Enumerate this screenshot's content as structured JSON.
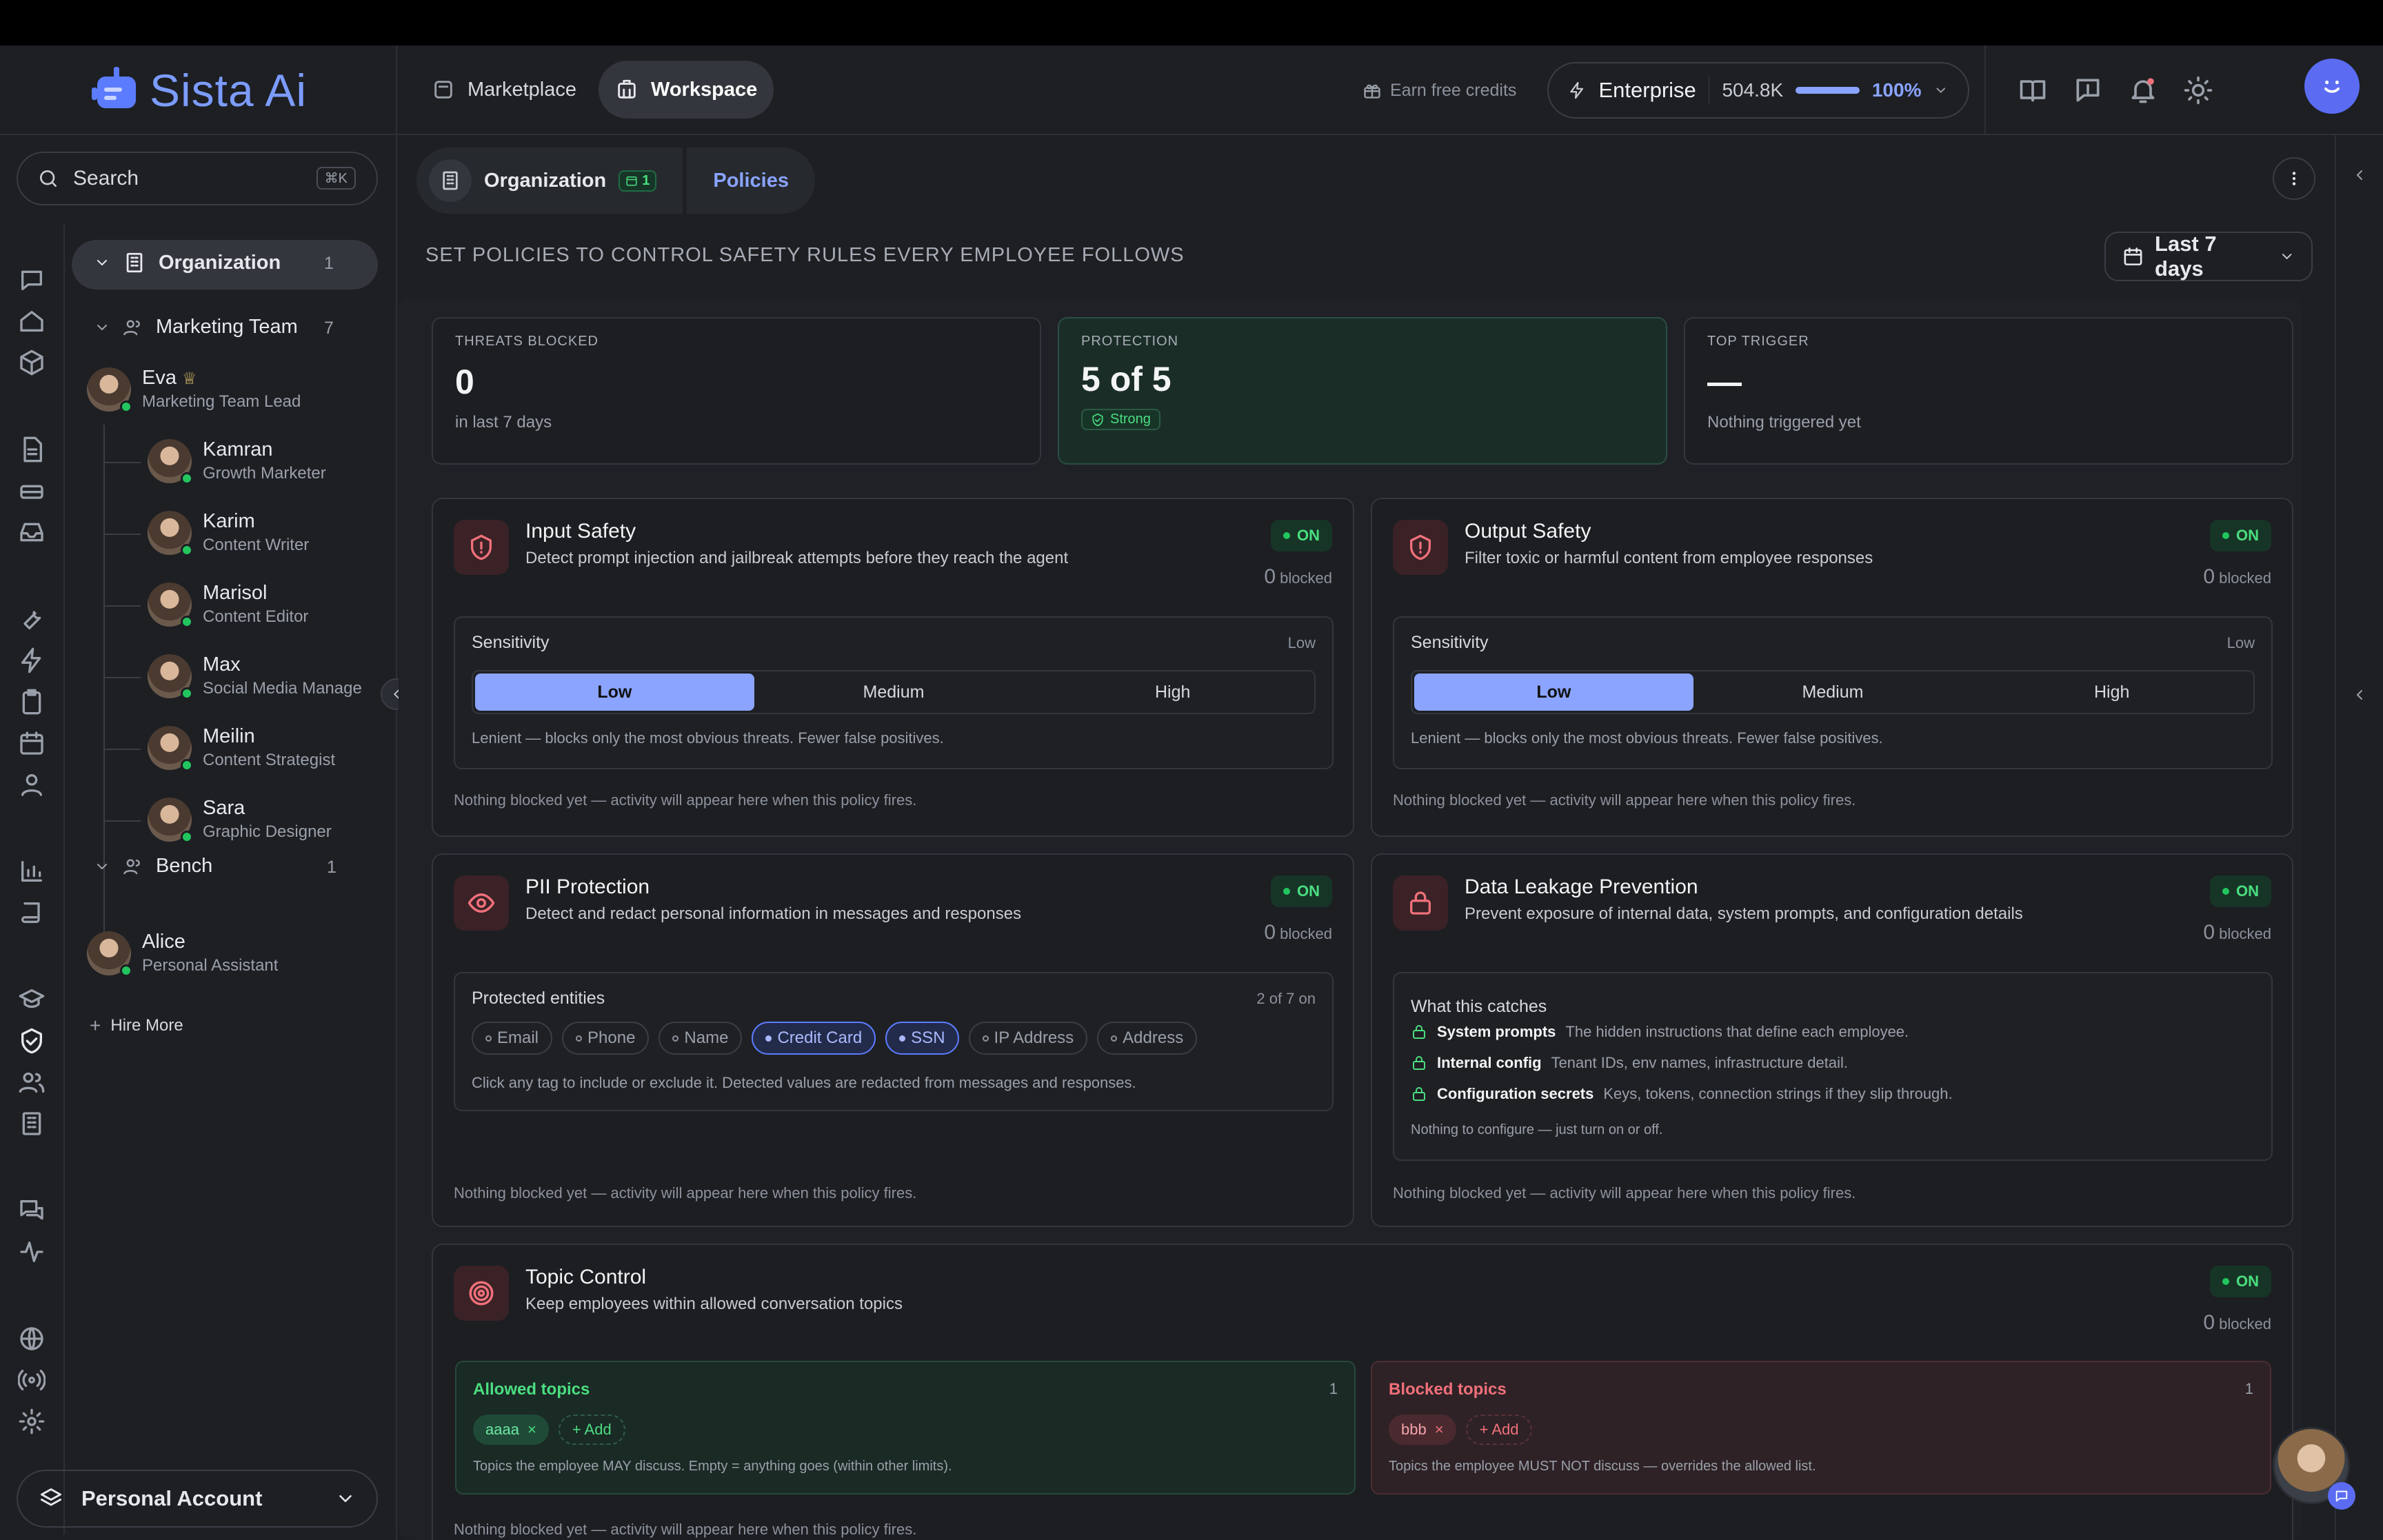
{
  "app": {
    "name": "Sista Ai"
  },
  "nav": {
    "marketplace": "Marketplace",
    "workspace": "Workspace"
  },
  "header": {
    "earn_credits": "Earn free credits",
    "plan": "Enterprise",
    "credits": "504.8K",
    "usage_percent": "100%",
    "usage_fraction": 1.0
  },
  "sidebar": {
    "search_placeholder": "Search",
    "search_shortcut": "⌘K",
    "org": {
      "label": "Organization",
      "count": "1"
    },
    "team": {
      "label": "Marketing Team",
      "count": "7"
    },
    "lead": {
      "name": "Eva",
      "role": "Marketing Team Lead"
    },
    "members": [
      {
        "name": "Kamran",
        "role": "Growth Marketer"
      },
      {
        "name": "Karim",
        "role": "Content Writer"
      },
      {
        "name": "Marisol",
        "role": "Content Editor"
      },
      {
        "name": "Max",
        "role": "Social Media Manager"
      },
      {
        "name": "Meilin",
        "role": "Content Strategist"
      },
      {
        "name": "Sara",
        "role": "Graphic Designer"
      }
    ],
    "bench": {
      "label": "Bench",
      "count": "1"
    },
    "bench_member": {
      "name": "Alice",
      "role": "Personal Assistant"
    },
    "hire_more": "Hire More",
    "account": "Personal Account"
  },
  "breadcrumb": {
    "org": "Organization",
    "org_badge": "1",
    "current": "Policies"
  },
  "page": {
    "heading": "SET POLICIES TO CONTROL SAFETY RULES EVERY EMPLOYEE FOLLOWS",
    "date_range": "Last 7 days"
  },
  "stats": [
    {
      "label": "THREATS BLOCKED",
      "value": "0",
      "sub": "in last 7 days"
    },
    {
      "label": "PROTECTION",
      "value": "5 of 5",
      "sub": "Strong"
    },
    {
      "label": "TOP TRIGGER",
      "value": "—",
      "sub": "Nothing triggered yet"
    }
  ],
  "policies": {
    "on_label": "ON",
    "blocked_count": "0",
    "blocked_label": "blocked",
    "empty_note": "Nothing blocked yet — activity will appear here when this policy fires.",
    "sensitivity_label": "Sensitivity",
    "sensitivity_value": "Low",
    "levels": [
      "Low",
      "Medium",
      "High"
    ],
    "sensitivity_note": "Lenient — blocks only the most obvious threats. Fewer false positives.",
    "input": {
      "title": "Input Safety",
      "desc": "Detect prompt injection and jailbreak attempts before they reach the agent"
    },
    "output": {
      "title": "Output Safety",
      "desc": "Filter toxic or harmful content from employee responses"
    },
    "pii": {
      "title": "PII Protection",
      "desc": "Detect and redact personal information in messages and responses",
      "entities_label": "Protected entities",
      "entities_count": "2 of 7 on",
      "entities": [
        "Email",
        "Phone",
        "Name",
        "Credit Card",
        "SSN",
        "IP Address",
        "Address"
      ],
      "note": "Click any tag to include or exclude it. Detected values are redacted from messages and responses."
    },
    "dlp": {
      "title": "Data Leakage Prevention",
      "desc": "Prevent exposure of internal data, system prompts, and configuration details",
      "catches_label": "What this catches",
      "catches": [
        {
          "name": "System prompts",
          "desc": "The hidden instructions that define each employee."
        },
        {
          "name": "Internal config",
          "desc": "Tenant IDs, env names, infrastructure detail."
        },
        {
          "name": "Configuration secrets",
          "desc": "Keys, tokens, connection strings if they slip through."
        }
      ],
      "note": "Nothing to configure — just turn on or off."
    },
    "topic": {
      "title": "Topic Control",
      "desc": "Keep employees within allowed conversation topics",
      "allowed_label": "Allowed topics",
      "allowed_count": "1",
      "allowed_tag": "aaaa",
      "add": "+ Add",
      "allowed_note": "Topics the employee MAY discuss. Empty = anything goes (within other limits).",
      "blocked_label": "Blocked topics",
      "blocked_count": "1",
      "blocked_tag": "bbb",
      "blocked_note": "Topics the employee MUST NOT discuss — overrides the allowed list."
    }
  },
  "colors": {
    "accent": "#8aa4ff",
    "on": "#4ade80",
    "danger": "#f0707a",
    "brand": "#5b6cf2"
  }
}
